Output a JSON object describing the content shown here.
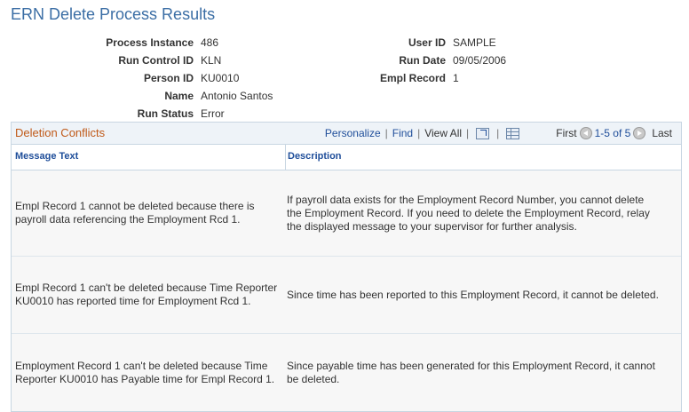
{
  "page": {
    "title": "ERN Delete Process Results"
  },
  "fields": {
    "left": [
      {
        "label": "Process Instance",
        "value": "486"
      },
      {
        "label": "Run Control ID",
        "value": "KLN"
      },
      {
        "label": "Person ID",
        "value": "KU0010"
      },
      {
        "label": "Name",
        "value": "Antonio Santos"
      },
      {
        "label": "Run Status",
        "value": "Error"
      }
    ],
    "right": [
      {
        "label": "User ID",
        "value": "SAMPLE"
      },
      {
        "label": "Run Date",
        "value": "09/05/2006"
      },
      {
        "label": "Empl Record",
        "value": "1"
      }
    ]
  },
  "grid": {
    "title": "Deletion Conflicts",
    "nav": {
      "personalize": "Personalize",
      "find": "Find",
      "view_all": "View All",
      "first": "First",
      "range": "1-5 of 5",
      "last": "Last"
    },
    "columns": {
      "message": "Message Text",
      "description": "Description"
    },
    "rows": [
      {
        "message": "Empl Record 1 cannot be deleted because there is payroll data referencing the Employment Rcd 1.",
        "description": "If payroll data exists for the Employment Record Number, you cannot delete the Employment Record. If you need to delete the Employment Record, relay the displayed message to your supervisor for further analysis."
      },
      {
        "message": "Empl Record 1 can't be deleted because Time Reporter KU0010 has reported time for Employment Rcd 1.",
        "description": "Since time has been reported to this Employment Record, it cannot be deleted."
      },
      {
        "message": "Employment Record 1 can't be deleted because Time Reporter KU0010 has Payable time for Empl Record 1.",
        "description": "Since payable time has been generated for this Employment Record, it cannot be deleted."
      }
    ]
  }
}
